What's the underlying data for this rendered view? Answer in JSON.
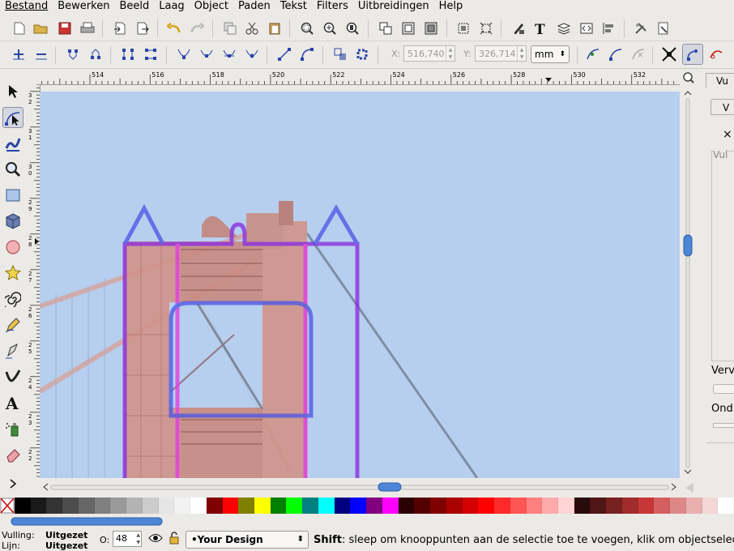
{
  "menu": [
    "Bestand",
    "Bewerken",
    "Beeld",
    "Laag",
    "Object",
    "Paden",
    "Tekst",
    "Filters",
    "Uitbreidingen",
    "Help"
  ],
  "toolbar2": {
    "x_label": "X:",
    "x_value": "516,740",
    "y_label": "Y:",
    "y_value": "326,714",
    "unit": "mm"
  },
  "ruler": {
    "h_labels": [
      "514",
      "516",
      "518",
      "520",
      "522",
      "524",
      "526",
      "528",
      "530",
      "532"
    ],
    "v_labels": [
      "3 2",
      "3 1",
      "3 0",
      "2 9",
      "2 8",
      "2 7",
      "2 6",
      "2 5",
      "2 4",
      "2 3",
      "2 2"
    ]
  },
  "right_panel": {
    "tab_label": "Vu",
    "tab2_label": "V",
    "close": "×",
    "fill_label": "Vul",
    "blur_label": "Verv",
    "opacity_label": "Ond"
  },
  "palette": [
    "#ffffff",
    "#000000",
    "#1a1a1a",
    "#333333",
    "#4d4d4d",
    "#666666",
    "#808080",
    "#999999",
    "#b3b3b3",
    "#cccccc",
    "#e6e6e6",
    "#f2f2f2",
    "#ffffff",
    "#800000",
    "#ff0000",
    "#808000",
    "#ffff00",
    "#008000",
    "#00ff00",
    "#008080",
    "#00ffff",
    "#000080",
    "#0000ff",
    "#800080",
    "#ff00ff",
    "#2b0000",
    "#550000",
    "#800000",
    "#aa0000",
    "#d40000",
    "#ff0000",
    "#ff2a2a",
    "#ff5555",
    "#ff8080",
    "#ffaaaa",
    "#ffd5d5",
    "#280b0b",
    "#501616",
    "#782121",
    "#a02c2c",
    "#c83737",
    "#d35f5f",
    "#de8787",
    "#e9afaf",
    "#f4d7d7",
    "#ffffff"
  ],
  "status": {
    "fill_label": "Vulling:",
    "fill_value": "Uitgezet",
    "stroke_label": "Lijn:",
    "stroke_value": "Uitgezet",
    "opacity_label": "O:",
    "opacity_value": "48",
    "layer": "•Your Design",
    "hint_bold": "Shift",
    "hint_text": ": sleep om knooppunten aan de selectie toe te voegen, klik om objectselecti"
  },
  "icons": [
    "new-icon",
    "open-icon",
    "save-icon",
    "print-icon",
    "import-icon",
    "export-icon",
    "undo-icon",
    "redo-icon",
    "duplicate-icon",
    "cut-icon",
    "paste-icon",
    "zoom-selection-icon",
    "zoom-drawing-icon",
    "zoom-page-icon",
    "group-icon",
    "ungroup-icon",
    "clone-icon",
    "align-icon",
    "transform-icon",
    "fill-stroke-icon",
    "text-icon",
    "layers-icon",
    "xml-editor-icon",
    "align-distribute-icon",
    "preferences-icon",
    "document-properties-icon"
  ],
  "tools": [
    "selector-tool-icon",
    "node-tool-icon",
    "tweak-tool-icon",
    "zoom-tool-icon",
    "rectangle-tool-icon",
    "3d-box-tool-icon",
    "ellipse-tool-icon",
    "star-tool-icon",
    "spiral-tool-icon",
    "pencil-tool-icon",
    "pen-tool-icon",
    "calligraphy-tool-icon",
    "text-tool-icon",
    "spray-tool-icon",
    "eraser-tool-icon",
    "more-tools-icon"
  ]
}
